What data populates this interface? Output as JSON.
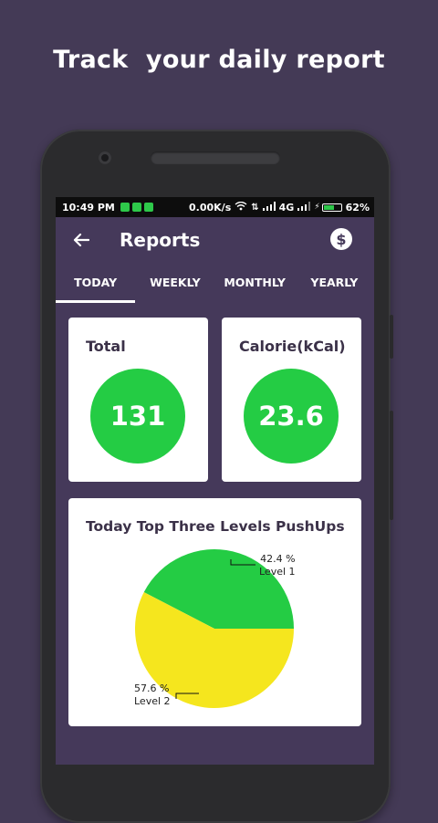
{
  "promo": {
    "headline": "Track  your daily report"
  },
  "status_bar": {
    "time": "10:49 PM",
    "speed": "0.00K/s",
    "network": "4G",
    "battery": "62%",
    "battery_level": 0.62
  },
  "app_bar": {
    "back_icon": "arrow-left-icon",
    "title": "Reports",
    "action_icon": "dollar-icon",
    "action_symbol": "$"
  },
  "tabs": [
    {
      "label": "TODAY",
      "active": true
    },
    {
      "label": "WEEKLY",
      "active": false
    },
    {
      "label": "MONTHLY",
      "active": false
    },
    {
      "label": "YEARLY",
      "active": false
    }
  ],
  "stats": {
    "total": {
      "label": "Total",
      "value": "131"
    },
    "calorie": {
      "label": "Calorie(kCal)",
      "value": "23.6"
    }
  },
  "colors": {
    "background": "#443a56",
    "accent_green": "#24cc44",
    "accent_yellow": "#f5e61e"
  },
  "chart_data": {
    "type": "pie",
    "title": "Today Top Three Levels PushUps",
    "slices": [
      {
        "name": "Level 1",
        "percent_label": "42.4 %",
        "value": 42.4,
        "color": "#24cc44"
      },
      {
        "name": "Level 2",
        "percent_label": "57.6 %",
        "value": 57.6,
        "color": "#f5e61e"
      }
    ]
  }
}
